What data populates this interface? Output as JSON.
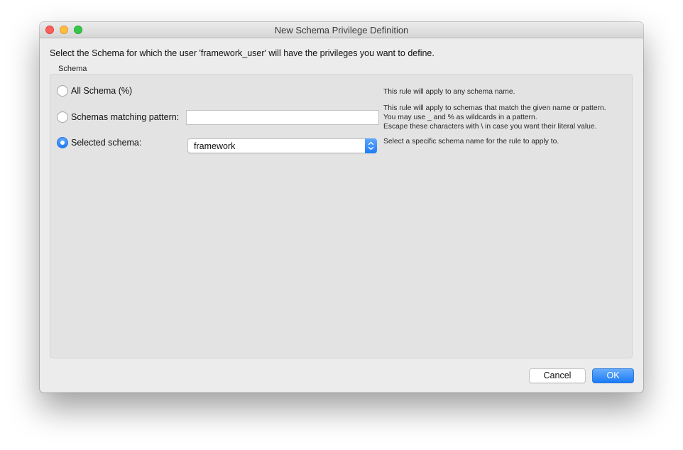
{
  "window": {
    "title": "New Schema Privilege Definition"
  },
  "instruction": "Select the Schema for which the user 'framework_user' will have the privileges you want to define.",
  "schema_group": {
    "label": "Schema",
    "options": [
      {
        "label": "All Schema (%)",
        "checked": false,
        "help": [
          "This rule will apply to any schema name."
        ]
      },
      {
        "label": "Schemas matching pattern:",
        "checked": false,
        "input_value": "",
        "help": [
          "This rule will apply to schemas that match the given name or pattern.",
          "You may use _ and % as wildcards in a pattern.",
          "Escape these characters with \\ in case you want their literal value."
        ]
      },
      {
        "label": "Selected schema:",
        "checked": true,
        "selected_value": "framework",
        "help": [
          "Select a specific schema name for the rule to apply to."
        ]
      }
    ]
  },
  "buttons": {
    "cancel": "Cancel",
    "ok": "OK"
  },
  "colors": {
    "accent": "#1f7cf5",
    "close": "#fc605c",
    "minimize": "#fdbc40",
    "maximize": "#34c84a"
  },
  "icons": {
    "select_arrows": "chevron-up-down-icon"
  }
}
